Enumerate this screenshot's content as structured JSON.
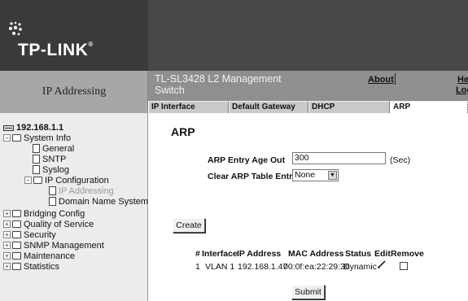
{
  "brand": {
    "logo_text": "TP-LINK",
    "logo_suffix": "®"
  },
  "page_title": "IP Addressing",
  "product": {
    "title": "TL-SL3428 L2 Management Switch"
  },
  "top_links": {
    "about": "About",
    "help": "Help",
    "logout": "Logout"
  },
  "tabs": [
    {
      "label": "IP Interface",
      "active": false
    },
    {
      "label": "Default Gateway",
      "active": false
    },
    {
      "label": "DHCP",
      "active": false
    },
    {
      "label": "ARP",
      "active": true
    }
  ],
  "sidebar": {
    "root": "192.168.1.1",
    "items": [
      {
        "label": "System Info",
        "icon": "folder-open-icon",
        "expander": "−"
      },
      {
        "label": "General",
        "icon": "document-icon"
      },
      {
        "label": "SNTP",
        "icon": "document-icon"
      },
      {
        "label": "Syslog",
        "icon": "document-icon"
      },
      {
        "label": "IP Configuration",
        "icon": "folder-open-icon",
        "expander": "−"
      },
      {
        "label": "IP Addressing",
        "icon": "document-icon",
        "selected": true
      },
      {
        "label": "Domain Name System",
        "icon": "document-icon"
      },
      {
        "label": "Bridging Config",
        "icon": "folder-icon",
        "expander": "+"
      },
      {
        "label": "Quality of Service",
        "icon": "folder-icon",
        "expander": "+"
      },
      {
        "label": "Security",
        "icon": "folder-icon",
        "expander": "+"
      },
      {
        "label": "SNMP Management",
        "icon": "folder-icon",
        "expander": "+"
      },
      {
        "label": "Maintenance",
        "icon": "folder-icon",
        "expander": "+"
      },
      {
        "label": "Statistics",
        "icon": "folder-icon",
        "expander": "+"
      }
    ]
  },
  "main": {
    "heading": "ARP",
    "age_out_label": "ARP Entry Age Out",
    "age_out_value": "300",
    "age_out_unit": "(Sec)",
    "clear_label": "Clear ARP Table Entries",
    "clear_value": "None",
    "create_button": "Create",
    "submit_button": "Submit",
    "table": {
      "headers": [
        "#",
        "Interface",
        "IP Address",
        "MAC Address",
        "Status",
        "Edit",
        "Remove"
      ],
      "rows": [
        {
          "num": "1",
          "interface": "VLAN 1",
          "ip": "192.168.1.47",
          "mac": "00:0f:ea:22:29:36",
          "status": "Dynamic",
          "edit_icon": "pencil-icon",
          "remove_checked": false
        }
      ]
    }
  },
  "colors": {
    "header_dark": "#3a3a3a",
    "header_mid": "#474747",
    "band": "#8f8f8f",
    "sidebar_bg": "#ececec"
  }
}
